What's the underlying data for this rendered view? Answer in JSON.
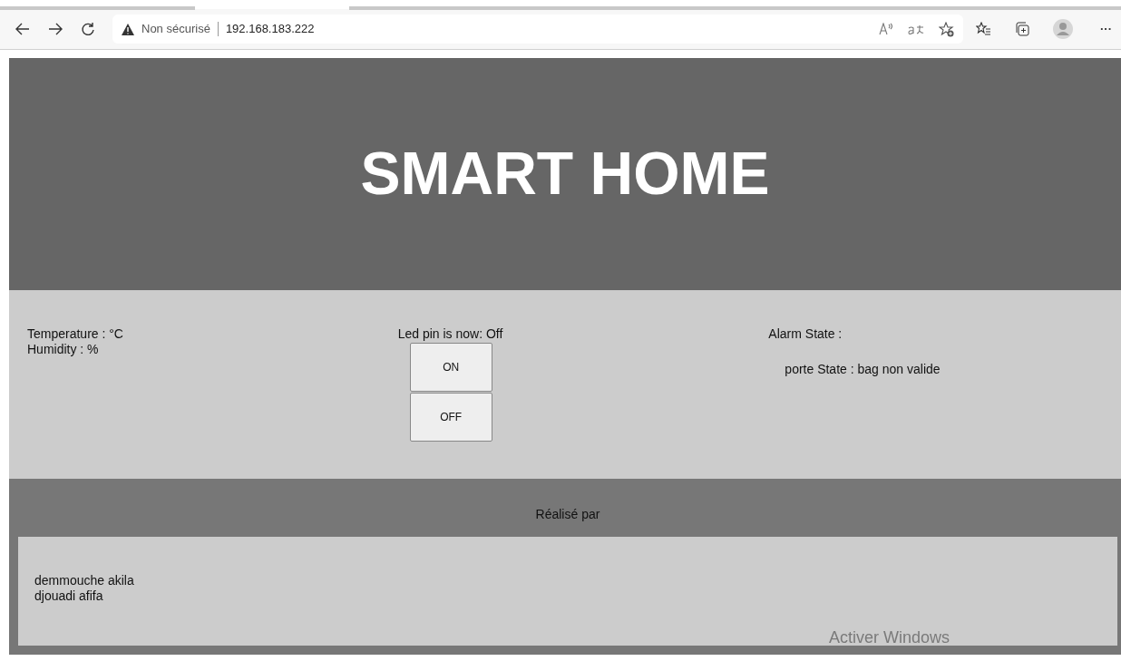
{
  "browser": {
    "security_label": "Non sécurisé",
    "url": "192.168.183.222",
    "menu_glyph": "···"
  },
  "header": {
    "title": "SMART HOME"
  },
  "sensors": [
    "Temperature : °C",
    "Humidity : %"
  ],
  "led": {
    "status": "Led pin is now: Off",
    "buttons": [
      "ON",
      "OFF"
    ]
  },
  "alarm": {
    "label": "Alarm State :",
    "porte": "porte State : bag non valide"
  },
  "footer": {
    "heading": "Réalisé par",
    "authors": [
      "demmouche akila",
      "djouadi afifa"
    ]
  },
  "os_notice": "Activer Windows"
}
